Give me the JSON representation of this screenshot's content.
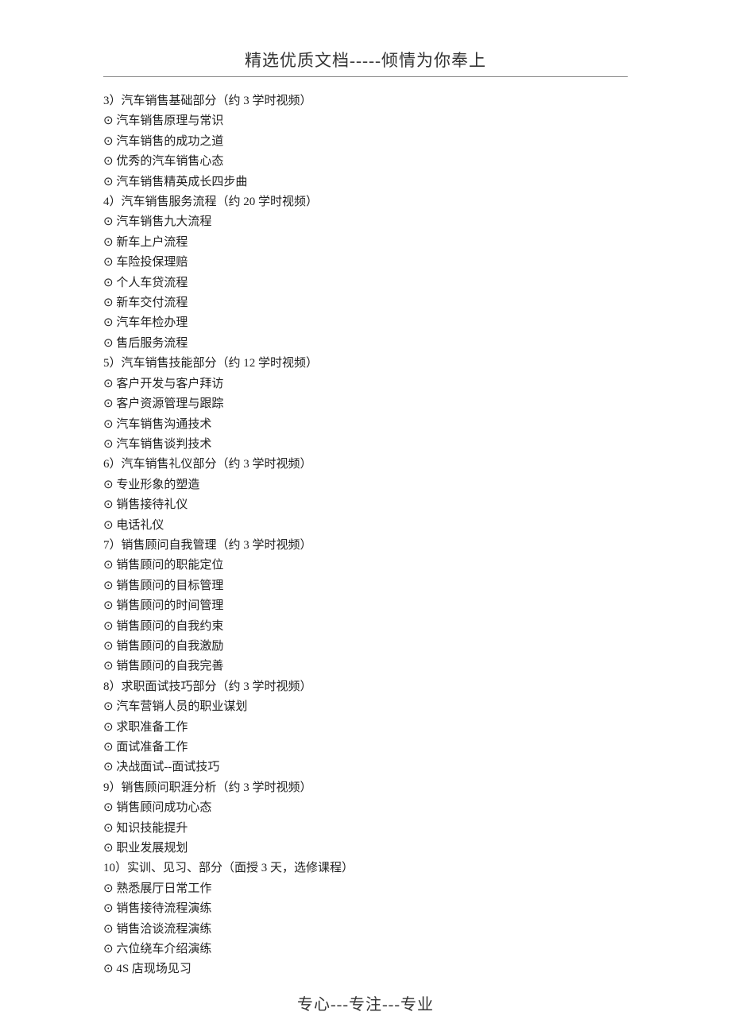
{
  "header": "精选优质文档-----倾情为你奉上",
  "footer": "专心---专注---专业",
  "bullet": "⊙",
  "sections": [
    {
      "title": "3）汽车销售基础部分（约 3 学时视频）",
      "items": [
        "汽车销售原理与常识",
        "汽车销售的成功之道",
        "优秀的汽车销售心态",
        "汽车销售精英成长四步曲"
      ]
    },
    {
      "title": "4）汽车销售服务流程（约 20 学时视频）",
      "items": [
        "汽车销售九大流程",
        "新车上户流程",
        "车险投保理赔",
        "个人车贷流程",
        "新车交付流程",
        "汽车年检办理",
        "售后服务流程"
      ]
    },
    {
      "title": "5）汽车销售技能部分（约 12 学时视频）",
      "items": [
        "客户开发与客户拜访",
        "客户资源管理与跟踪",
        "汽车销售沟通技术",
        "汽车销售谈判技术"
      ]
    },
    {
      "title": "6）汽车销售礼仪部分（约 3 学时视频）",
      "items": [
        "专业形象的塑造",
        "销售接待礼仪",
        "电话礼仪"
      ]
    },
    {
      "title": "7）销售顾问自我管理（约 3 学时视频）",
      "items": [
        "销售顾问的职能定位",
        "销售顾问的目标管理",
        "销售顾问的时间管理",
        "销售顾问的自我约束",
        "销售顾问的自我激励",
        "销售顾问的自我完善"
      ]
    },
    {
      "title": "8）求职面试技巧部分（约 3 学时视频）",
      "items": [
        "汽车营销人员的职业谋划",
        "求职准备工作",
        "面试准备工作",
        "决战面试--面试技巧"
      ]
    },
    {
      "title": "9）销售顾问职涯分析（约 3 学时视频）",
      "items": [
        "销售顾问成功心态",
        "知识技能提升",
        "职业发展规划"
      ]
    },
    {
      "title": "10）实训、见习、部分（面授 3 天，选修课程）",
      "items": [
        "熟悉展厅日常工作",
        "销售接待流程演练",
        "销售洽谈流程演练",
        "六位绕车介绍演练",
        "4S 店现场见习"
      ]
    }
  ]
}
